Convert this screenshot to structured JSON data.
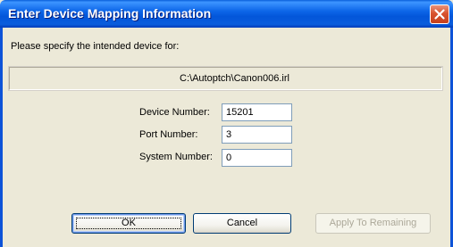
{
  "dialog": {
    "title": "Enter Device Mapping Information",
    "close_icon": "close-x-icon",
    "prompt": "Please specify the intended device for:",
    "file_path": "C:\\Autoptch\\Canon006.irl"
  },
  "fields": {
    "device_number": {
      "label": "Device Number:",
      "value": "15201"
    },
    "port_number": {
      "label": "Port Number:",
      "value": "3"
    },
    "system_number": {
      "label": "System Number:",
      "value": "0"
    }
  },
  "buttons": {
    "ok": "OK",
    "cancel": "Cancel",
    "apply_remaining": "Apply To Remaining"
  },
  "colors": {
    "titlebar": "#0356DA",
    "dialog_background": "#ECE9D8",
    "close_button": "#D9532E",
    "disabled_text": "#ACA899"
  }
}
